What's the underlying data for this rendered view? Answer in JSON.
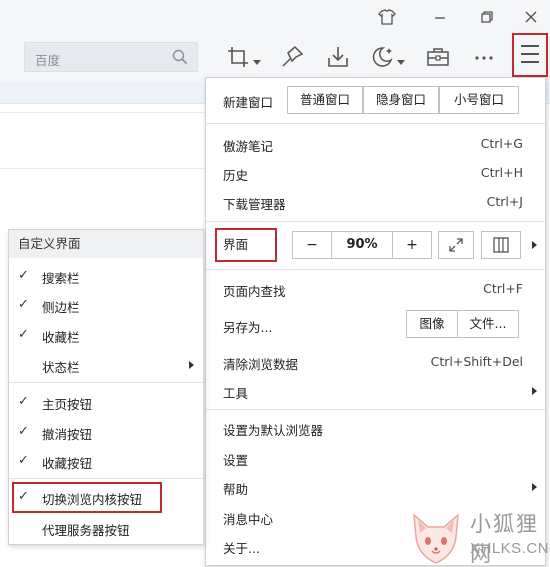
{
  "search": {
    "placeholder": "百度"
  },
  "toolbar_icons": [
    "screenshot-icon",
    "bookmark-pin-icon",
    "download-icon",
    "night-mode-icon",
    "toolbox-icon",
    "more-icon",
    "menu-icon"
  ],
  "main_menu": {
    "window_buttons": [
      "新建窗口",
      "普通窗口",
      "隐身窗口",
      "小号窗口"
    ],
    "items": {
      "notes": {
        "label": "傲游笔记",
        "shortcut": "Ctrl+G"
      },
      "history": {
        "label": "历史",
        "shortcut": "Ctrl+H"
      },
      "downloads": {
        "label": "下载管理器",
        "shortcut": "Ctrl+J"
      },
      "find": {
        "label": "页面内查找",
        "shortcut": "Ctrl+F"
      },
      "save_as": {
        "label": "另存为..."
      },
      "clear_data": {
        "label": "清除浏览数据",
        "shortcut": "Ctrl+Shift+Del"
      },
      "tools": {
        "label": "工具"
      },
      "set_default": {
        "label": "设置为默认浏览器"
      },
      "settings": {
        "label": "设置"
      },
      "help": {
        "label": "帮助"
      },
      "messages": {
        "label": "消息中心"
      },
      "about": {
        "label": "关于..."
      }
    },
    "interface": {
      "label": "界面",
      "zoom_minus": "−",
      "zoom_value": "90%",
      "zoom_plus": "+"
    },
    "save_buttons": {
      "image": "图像",
      "file": "文件..."
    }
  },
  "side_panel": {
    "title": "自定义界面",
    "items": [
      {
        "label": "搜索栏",
        "checked": true
      },
      {
        "label": "侧边栏",
        "checked": true
      },
      {
        "label": "收藏栏",
        "checked": true
      },
      {
        "label": "状态栏",
        "checked": false
      },
      {
        "label": "主页按钮",
        "checked": true
      },
      {
        "label": "撤消按钮",
        "checked": true
      },
      {
        "label": "收藏按钮",
        "checked": true
      },
      {
        "label": "切换浏览内核按钮",
        "checked": true
      },
      {
        "label": "代理服务器按钮",
        "checked": false
      }
    ],
    "check_mark": "✓"
  },
  "watermark": {
    "cn": "小狐狸网",
    "en": "XHLKS.CN"
  },
  "colors": {
    "highlight": "#c12a2f",
    "chrome_bg": "#f4f6f8"
  }
}
